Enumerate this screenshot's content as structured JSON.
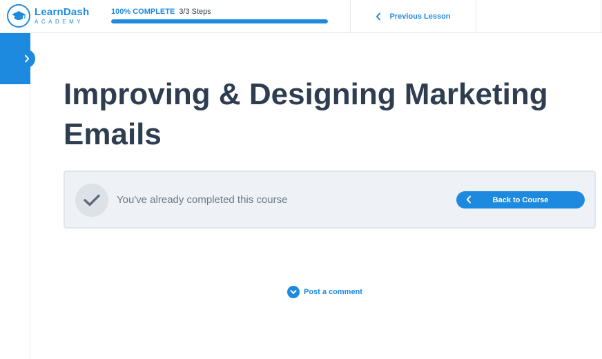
{
  "brand": {
    "name": "LearnDash",
    "tagline": "ACADEMY",
    "icon": "graduation-cap-icon",
    "color": "#1d8ae0"
  },
  "progress": {
    "percent_label": "100% COMPLETE",
    "steps_label": "3/3 Steps",
    "fraction": 1.0
  },
  "nav": {
    "previous_label": "Previous Lesson",
    "previous_icon": "chevron-left-icon"
  },
  "sidebar": {
    "toggle_icon": "chevron-right-icon"
  },
  "lesson": {
    "title": "Improving & Designing Marketing Emails"
  },
  "completion": {
    "icon": "checkmark-icon",
    "message": "You've already completed this course",
    "back_label": "Back to Course",
    "back_icon": "chevron-left-icon"
  },
  "comments": {
    "link_label": "Post a comment",
    "icon": "chevron-down-circle-icon"
  },
  "colors": {
    "accent": "#1d8ae0",
    "heading": "#2e3e50",
    "panel_bg": "#eef2f6"
  }
}
